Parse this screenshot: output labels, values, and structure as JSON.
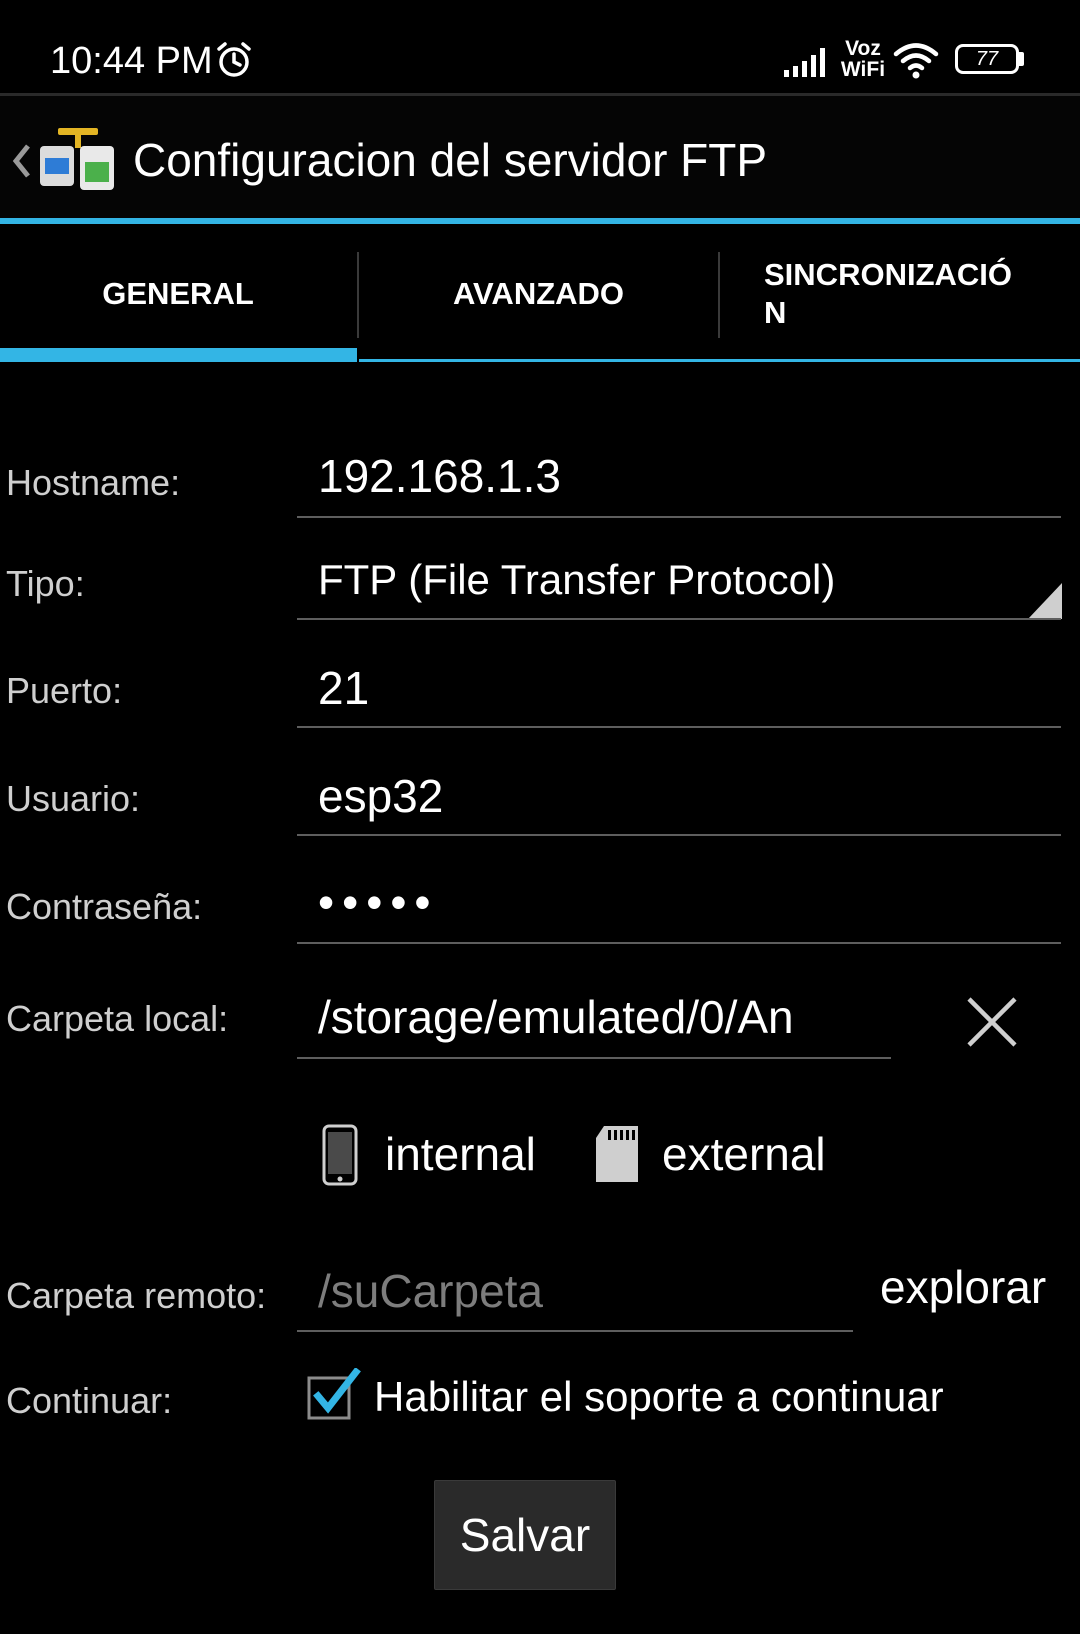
{
  "status_bar": {
    "time": "10:44 PM",
    "network_label_top": "Voz",
    "network_label_bottom": "WiFi",
    "battery": "77"
  },
  "action_bar": {
    "title": "Configuracion del servidor FTP",
    "icons": [
      "back-chevron-icon",
      "ftp-server-icon"
    ]
  },
  "tabs": [
    {
      "label": "GENERAL",
      "active": true
    },
    {
      "label": "AVANZADO",
      "active": false
    },
    {
      "label": "SINCRONIZACIÓN",
      "label_line1": "SINCRONIZACIÓ",
      "label_line2": "N",
      "active": false
    }
  ],
  "form": {
    "hostname": {
      "label": "Hostname:",
      "value": "192.168.1.3"
    },
    "tipo": {
      "label": "Tipo:",
      "value": "FTP (File Transfer Protocol)"
    },
    "puerto": {
      "label": "Puerto:",
      "value": "21"
    },
    "usuario": {
      "label": "Usuario:",
      "value": "esp32"
    },
    "contrasena": {
      "label": "Contraseña:",
      "value": "•••••"
    },
    "carpeta_local": {
      "label": "Carpeta local:",
      "value": "/storage/emulated/0/An"
    },
    "storage": {
      "internal": "internal",
      "external": "external"
    },
    "carpeta_remoto": {
      "label": "Carpeta remoto:",
      "placeholder": "/suCarpeta",
      "value": ""
    },
    "explorar": "explorar",
    "continuar": {
      "label": "Continuar:",
      "checkbox_label": "Habilitar el soporte a continuar",
      "checked": true
    }
  },
  "save_button": "Salvar",
  "colors": {
    "accent": "#33b5e5",
    "background": "#000000",
    "field_line": "#5e5e5e"
  }
}
